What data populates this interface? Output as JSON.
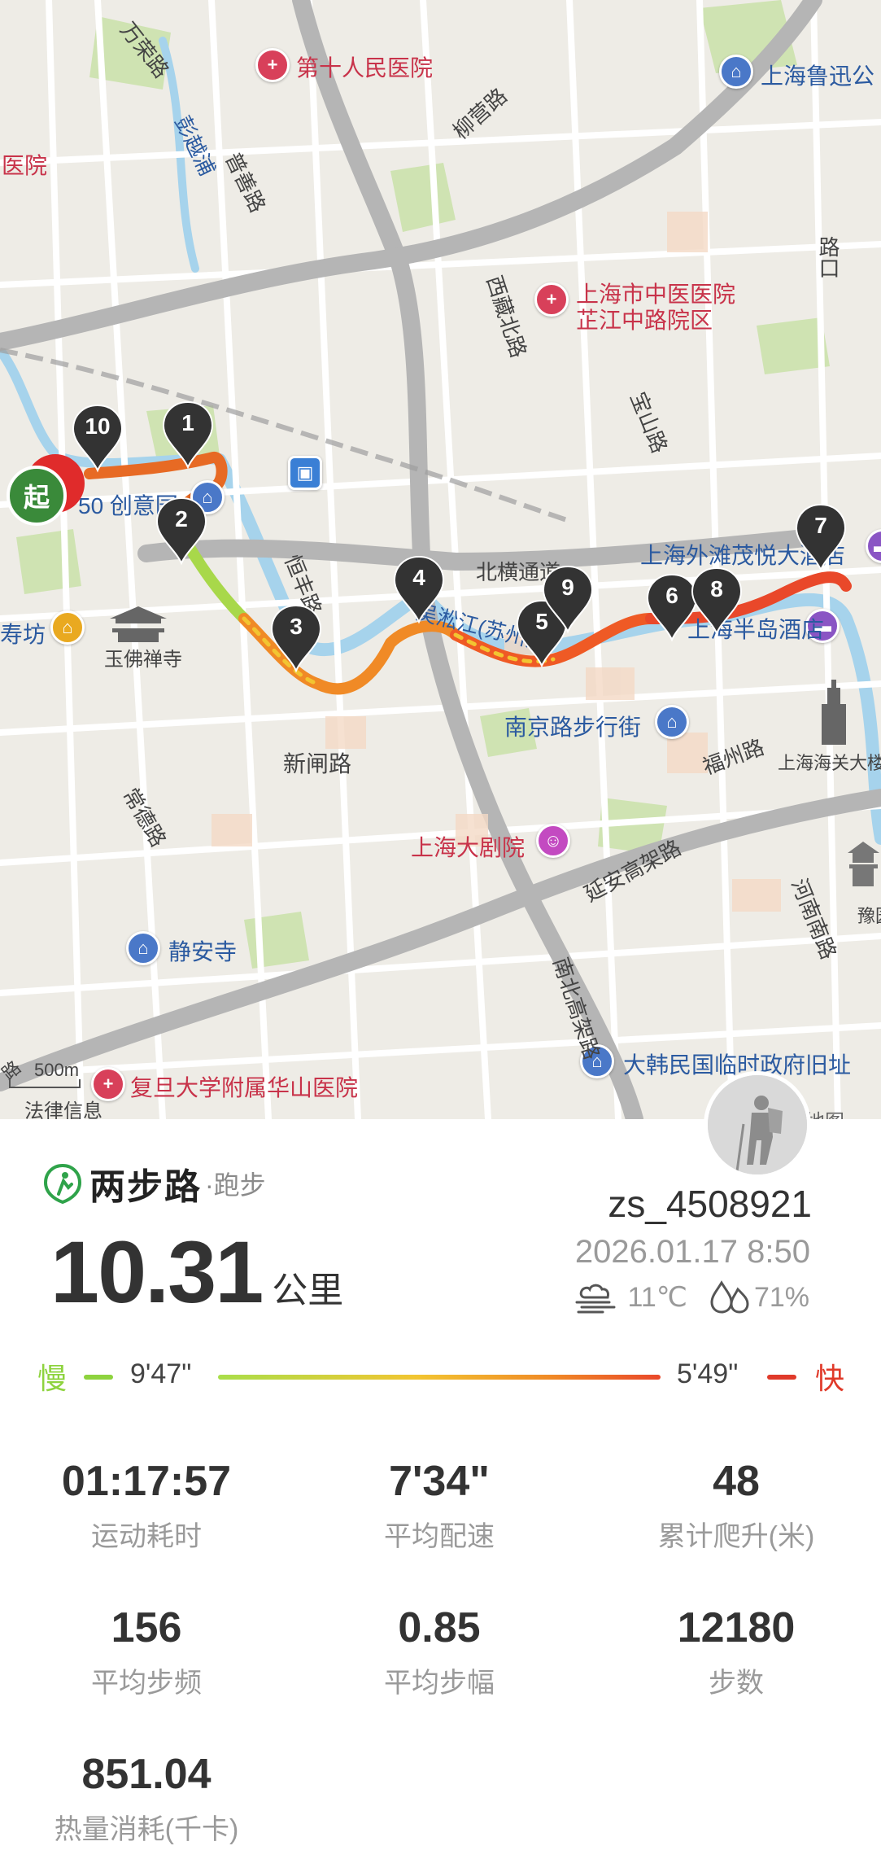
{
  "map": {
    "labels": {
      "l0": "万荣路",
      "l1": "彭越浦",
      "l2": "普善路",
      "l3": "第十人民医院",
      "l4": "柳营路",
      "l5": "上海鲁迅公",
      "l6": "医院",
      "l7": "上海市中医医院",
      "l8": "芷江中路院区",
      "l9": "西藏北路",
      "l10": "宝山路",
      "l11": "路口",
      "l12": "50 创意园",
      "l13": "恒丰路",
      "l14": "北横通道",
      "l15": "上海外滩茂悦大酒店",
      "l16": "吴淞江(苏州河)",
      "l17": "上海半岛酒店",
      "l18": "寿坊",
      "l19": "玉佛禅寺",
      "l20": "新闸路",
      "l21": "南京路步行街",
      "l22": "福州路",
      "l23": "上海海关大楼",
      "l24": "常德路",
      "l25": "上海大剧院",
      "l26": "延安高架路",
      "l27": "河南南路",
      "l28": "豫园",
      "l29": "静安寺",
      "l30": "南北高架路",
      "l31": "大韩民国临时政府旧址",
      "l32": "复旦大学附属华山医院",
      "l33": "路"
    },
    "km_markers": [
      "1",
      "2",
      "3",
      "4",
      "5",
      "6",
      "7",
      "8",
      "9",
      "10"
    ],
    "start_label": "起",
    "scale_label": "500m",
    "legal_label": "法律信息",
    "attribution": "地图"
  },
  "card": {
    "brand_name": "两步路",
    "sport_label": "·跑步",
    "username": "zs_4508921",
    "distance_value": "10.31",
    "distance_unit": "公里",
    "datetime": "2026.01.17 8:50",
    "temperature": "11℃",
    "humidity": "71%",
    "pace_legend": {
      "slow_label": "慢",
      "slow_value": "9'47\"",
      "fast_value": "5'49\"",
      "fast_label": "快"
    },
    "stats": [
      {
        "value": "01:17:57",
        "label": "运动耗时"
      },
      {
        "value": "7'34\"",
        "label": "平均配速"
      },
      {
        "value": "48",
        "label": "累计爬升(米)"
      },
      {
        "value": "156",
        "label": "平均步频"
      },
      {
        "value": "0.85",
        "label": "平均步幅"
      },
      {
        "value": "12180",
        "label": "步数"
      },
      {
        "value": "851.04",
        "label": "热量消耗(千卡)"
      }
    ]
  },
  "colors": {
    "slow": "#8ed33e",
    "fast": "#e03a2a",
    "start_pin": "#3a8a3a",
    "km_pin": "#333333"
  }
}
